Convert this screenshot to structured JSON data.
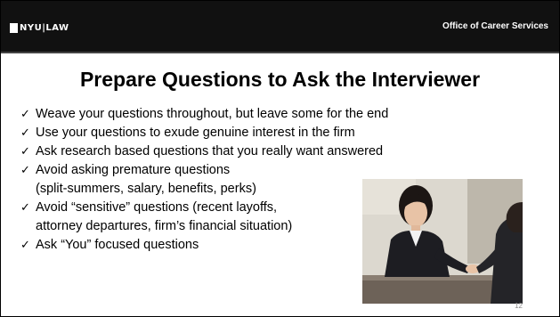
{
  "header": {
    "logo_text": "NYU|LAW",
    "office": "Office of Career Services"
  },
  "title": "Prepare Questions to Ask the Interviewer",
  "bullets": [
    {
      "lines": [
        "Weave your questions throughout, but leave some for the end"
      ]
    },
    {
      "lines": [
        "Use your questions to exude genuine interest in the firm"
      ]
    },
    {
      "lines": [
        "Ask research based questions that you really want answered"
      ]
    },
    {
      "lines": [
        "Avoid asking premature questions",
        "(split-summers, salary, benefits, perks)"
      ]
    },
    {
      "lines": [
        "Avoid “sensitive” questions (recent layoffs,",
        "attorney departures, firm’s financial situation)"
      ]
    },
    {
      "lines": [
        "Ask “You” focused questions"
      ]
    }
  ],
  "check_glyph": "✓",
  "photo": {
    "icon": "handshake-interview-photo"
  },
  "page_number": "12"
}
